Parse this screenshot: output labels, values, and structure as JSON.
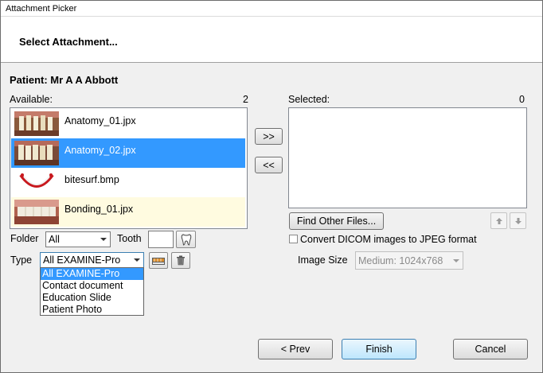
{
  "window": {
    "title": "Attachment Picker"
  },
  "header": {
    "title": "Select Attachment..."
  },
  "patient": {
    "label": "Patient: Mr A A Abbott"
  },
  "available": {
    "label": "Available:",
    "count": "2",
    "items": [
      {
        "name": "Anatomy_01.jpx",
        "selected": false
      },
      {
        "name": "Anatomy_02.jpx",
        "selected": true
      },
      {
        "name": "bitesurf.bmp",
        "selected": false
      },
      {
        "name": "Bonding_01.jpx",
        "selected": false,
        "highlight": true
      }
    ]
  },
  "selected_list": {
    "label": "Selected:",
    "count": "0"
  },
  "buttons": {
    "add": ">>",
    "remove": "<<",
    "find_other": "Find Other Files...",
    "prev": "< Prev",
    "finish": "Finish",
    "cancel": "Cancel"
  },
  "filters": {
    "folder_label": "Folder",
    "folder_value": "All",
    "tooth_label": "Tooth",
    "tooth_value": "",
    "type_label": "Type",
    "type_value": "All EXAMINE-Pro",
    "type_options": [
      "All EXAMINE-Pro",
      "Contact document",
      "Education Slide",
      "Patient Photo"
    ]
  },
  "convert": {
    "label": "Convert DICOM images to JPEG format",
    "checked": false
  },
  "image_size": {
    "label": "Image Size",
    "value": "Medium: 1024x768"
  },
  "icons": {
    "tooth": "tooth-icon",
    "scanner": "scanner-icon",
    "trash": "trash-icon",
    "move_up": "arrow-up-icon",
    "move_down": "arrow-down-icon"
  },
  "colors": {
    "selection": "#3399ff",
    "highlight_row": "#fffbe0"
  }
}
